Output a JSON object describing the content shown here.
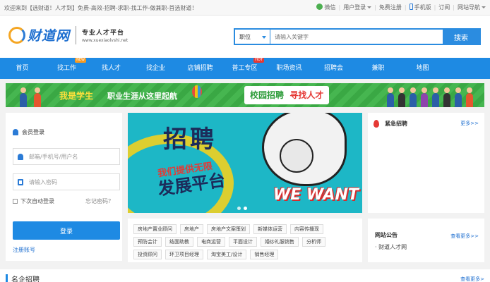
{
  "topbar": {
    "welcome": "欢迎来到【选财道！人才到】免费-高效-招聘-求职-找工作-做兼职-首选财道！",
    "wechat": "微信",
    "user_login": "用户登录",
    "register": "免费注册",
    "mobile": "手机版",
    "subscribe": "订阅",
    "site_nav": "网站导航"
  },
  "logo": {
    "name": "财道网",
    "tagline": "专业人才平台",
    "domain": "www.xuexiaolvshi.net"
  },
  "search": {
    "category": "职位",
    "placeholder": "请输入关键字",
    "button": "搜索"
  },
  "nav": {
    "items": [
      {
        "label": "首页"
      },
      {
        "label": "找工作",
        "badge": "NEW"
      },
      {
        "label": "找人才"
      },
      {
        "label": "找企业"
      },
      {
        "label": "店铺招聘"
      },
      {
        "label": "普工专区",
        "badge": "HOT"
      },
      {
        "label": "职场资讯"
      },
      {
        "label": "招聘会"
      },
      {
        "label": "兼职"
      },
      {
        "label": "地图"
      }
    ]
  },
  "banner": {
    "left_highlight": "我是学生",
    "left_text": "职业生涯从这里起航",
    "right_text": "校园招聘",
    "right_highlight": "寻找人才"
  },
  "login": {
    "title": "会员登录",
    "account_placeholder": "邮箱/手机号/用户名",
    "password_placeholder": "请输入密码",
    "remember": "下次自动登录",
    "forgot": "忘记密码？",
    "button": "登录",
    "register": "注册账号"
  },
  "carousel": {
    "headline": "招聘",
    "line1": "我们提供无限",
    "line2": "发展平台",
    "slogan": "WE WANT YOU"
  },
  "tags": {
    "rows": [
      [
        "房地产置业顾问",
        "房地产",
        "房地产文案策划",
        "新媒体运营",
        "内容传播现"
      ],
      [
        "预防会计",
        "结面助教",
        "电商运营",
        "平面设计",
        "婚纱礼服销售",
        "分析师"
      ],
      [
        "投资顾问",
        "环卫项目经理",
        "淘宝美工/设计",
        "销售经理"
      ]
    ]
  },
  "urgent": {
    "title": "紧急招聘",
    "more": "更多>>"
  },
  "notice": {
    "title": "网站公告",
    "more": "查看更多>>",
    "items": [
      "· 财道人才网"
    ]
  },
  "section": {
    "title": "名企招聘",
    "more": "查看更多>"
  },
  "colors": {
    "primary": "#1e8ae3",
    "banner_green": "#3fae49",
    "carousel_teal": "#1db7c6"
  }
}
